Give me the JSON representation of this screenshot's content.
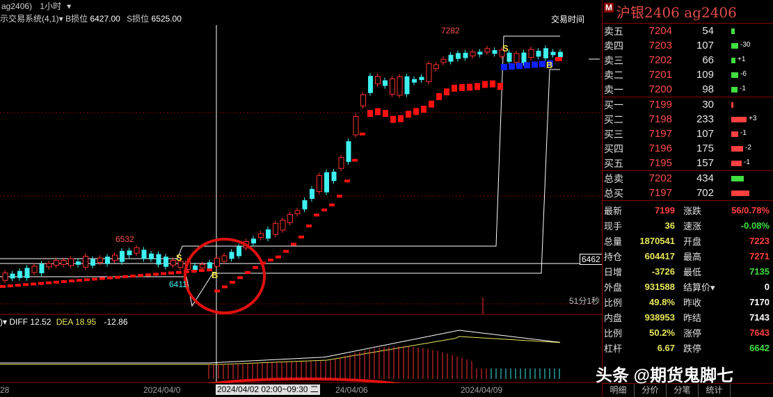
{
  "top_bar": {
    "symbol_code": "ag2406)",
    "period": "1小时",
    "period_arrow": "▾"
  },
  "sys_bar": {
    "system_name": "示交易系统(4,1)",
    "arrow": "▾",
    "b_stop_label": "B损位",
    "b_stop_value": "6427.00",
    "s_stop_label": "S损位",
    "s_stop_value": "6525.00"
  },
  "trade_time_label": "交易时间",
  "price_labels": {
    "high": "7282",
    "left_high": "6532",
    "left_low": "6411",
    "current_tag": "6462"
  },
  "signals": {
    "s1": "S",
    "b1": "B",
    "s2": "S",
    "b2": "B"
  },
  "period_label": "51分1秒",
  "macd": {
    "prefix": ")",
    "arrow": "▾",
    "diff_label": "DIFF",
    "diff_value": "12.52",
    "dea_label": "DEA",
    "dea_value": "18.95",
    "macd_value": "-12.86"
  },
  "time_axis": {
    "t0": "28",
    "t1": "2024/04/0",
    "t2": "24/04/06",
    "t3": "2024/04/09",
    "cross": "2024/04/02 02:00~09:30 二"
  },
  "quote": {
    "badge": "M",
    "title": "沪银2406  ag2406",
    "asks": [
      {
        "label": "卖五",
        "price": "7204",
        "vol": "54",
        "chg": "",
        "bar": 5
      },
      {
        "label": "卖四",
        "price": "7203",
        "vol": "107",
        "chg": "-30",
        "bar": 10
      },
      {
        "label": "卖三",
        "price": "7202",
        "vol": "66",
        "chg": "+1",
        "bar": 6
      },
      {
        "label": "卖二",
        "price": "7201",
        "vol": "109",
        "chg": "-6",
        "bar": 10
      },
      {
        "label": "卖一",
        "price": "7200",
        "vol": "98",
        "chg": "-1",
        "bar": 9
      }
    ],
    "bids": [
      {
        "label": "买一",
        "price": "7199",
        "vol": "30",
        "chg": "",
        "bar": 3
      },
      {
        "label": "买二",
        "price": "7198",
        "vol": "233",
        "chg": "+3",
        "bar": 22
      },
      {
        "label": "买三",
        "price": "7197",
        "vol": "107",
        "chg": "-1",
        "bar": 10
      },
      {
        "label": "买四",
        "price": "7196",
        "vol": "175",
        "chg": "-2",
        "bar": 17
      },
      {
        "label": "买五",
        "price": "7195",
        "vol": "157",
        "chg": "-1",
        "bar": 15
      }
    ],
    "totals": [
      {
        "label": "总卖",
        "price": "7202",
        "vol": "434",
        "bar": 18,
        "color": "#40e040"
      },
      {
        "label": "总买",
        "price": "7197",
        "vol": "702",
        "bar": 26,
        "color": "#ff4040"
      }
    ],
    "stats": [
      {
        "k": "最新",
        "v": "7199",
        "vc": "red",
        "k2": "涨跌",
        "v2": "56/0.78%",
        "v2c": "red"
      },
      {
        "k": "现手",
        "v": "36",
        "vc": "yellow",
        "k2": "速涨",
        "v2": "-0.08%",
        "v2c": "green"
      },
      {
        "k": "总量",
        "v": "1870541",
        "vc": "yellow",
        "k2": "开盘",
        "v2": "7223",
        "v2c": "red"
      },
      {
        "k": "持仓",
        "v": "604417",
        "vc": "yellow",
        "k2": "最高",
        "v2": "7271",
        "v2c": "red"
      },
      {
        "k": "日增",
        "v": "-3726",
        "vc": "yellow",
        "k2": "最低",
        "v2": "7135",
        "v2c": "green"
      },
      {
        "k": "外盘",
        "v": "931588",
        "vc": "yellow",
        "k2": "结算价▾",
        "v2": "0",
        "v2c": "white"
      },
      {
        "k": "比例",
        "v": "49.8%",
        "vc": "yellow",
        "k2": "昨收",
        "v2": "7170",
        "v2c": "white"
      },
      {
        "k": "内盘",
        "v": "938953",
        "vc": "yellow",
        "k2": "昨结",
        "v2": "7143",
        "v2c": "white"
      },
      {
        "k": "比例",
        "v": "50.2%",
        "vc": "yellow",
        "k2": "涨停",
        "v2": "7643",
        "v2c": "red"
      },
      {
        "k": "杠杆",
        "v": "6.67",
        "vc": "yellow",
        "k2": "跌停",
        "v2": "6642",
        "v2c": "green"
      }
    ],
    "tabs": [
      "明细",
      "分价",
      "分笔",
      "统计"
    ]
  },
  "watermark": "头条 @期货鬼脚七",
  "colors": {
    "up": "#ff3030",
    "down": "#3ef0f0",
    "stop_red": "#ff0000",
    "stop_blue": "#1020ff",
    "signal": "#f0e040"
  }
}
